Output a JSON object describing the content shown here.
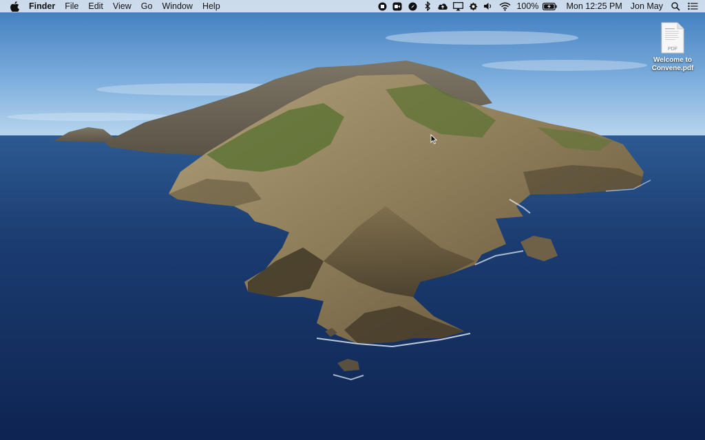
{
  "menubar": {
    "app_name": "Finder",
    "menus": [
      "File",
      "Edit",
      "View",
      "Go",
      "Window",
      "Help"
    ],
    "status_icons": [
      "record-icon",
      "facetime-camera-icon",
      "safari-compass-icon",
      "bluetooth-icon",
      "cloud-upload-icon",
      "airplay-icon",
      "gear-icon",
      "volume-icon",
      "wifi-icon"
    ],
    "battery_percent": "100%",
    "clock": "Mon 12:25 PM",
    "user_name": "Jon May"
  },
  "desktop": {
    "file": {
      "type_label": "PDF",
      "name_line1": "Welcome to",
      "name_line2": "Convene.pdf"
    }
  },
  "colors": {
    "sky_top": "#3f7fc2",
    "sky_bottom": "#9ec4e6",
    "ocean": "#1d3f72",
    "ocean_deep": "#0f2550",
    "rock": "#8a7a58",
    "vegetation": "#4e6a2e"
  }
}
